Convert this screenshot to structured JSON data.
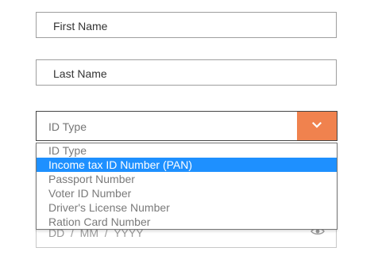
{
  "form": {
    "first_name_placeholder": "First Name",
    "last_name_placeholder": "Last Name",
    "id_type_selected": "ID Type",
    "id_type_options": [
      "ID Type",
      "Income tax ID Number (PAN)",
      "Passport Number",
      "Voter ID Number",
      "Driver's License Number",
      "Ration Card Number"
    ],
    "highlighted_option_index": 1,
    "dob_placeholder": "DD  /  MM  /  YYYY"
  },
  "colors": {
    "accent": "#f0824e",
    "highlight": "#1e90ff"
  },
  "icons": {
    "dropdown": "chevron-down-icon",
    "dob": "eye-icon"
  }
}
